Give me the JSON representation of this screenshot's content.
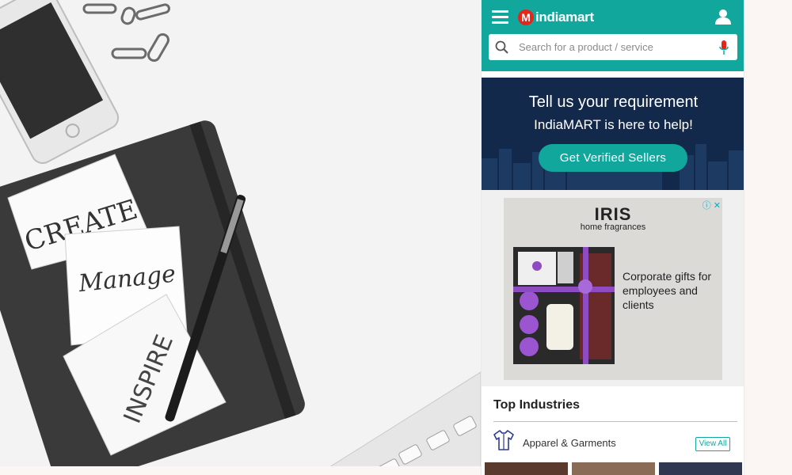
{
  "header": {
    "logo_mark": "M",
    "logo_text": "indiamart",
    "menu_icon": "hamburger-icon",
    "profile_icon": "user-icon"
  },
  "search": {
    "placeholder": "Search for a product / service",
    "search_icon": "search-icon",
    "mic_icon": "microphone-icon"
  },
  "hero": {
    "title": "Tell us your requirement",
    "subtitle": "IndiaMART is here to help!",
    "cta_label": "Get Verified Sellers"
  },
  "ad": {
    "brand": "IRIS",
    "brand_sub": "home fragrances",
    "copy": "Corporate gifts for employees and clients",
    "info_icon": "info-icon",
    "close_icon": "close-icon"
  },
  "top_industries": {
    "title": "Top Industries",
    "items": [
      {
        "label": "Apparel & Garments",
        "icon": "shirt-icon",
        "action_label": "View All"
      }
    ]
  },
  "background_photo": {
    "notes": [
      "CREATE",
      "Manage",
      "INSPIRE"
    ]
  },
  "colors": {
    "brand_teal": "#12a79d",
    "hero_navy": "#13294b",
    "logo_red": "#e3261b"
  }
}
